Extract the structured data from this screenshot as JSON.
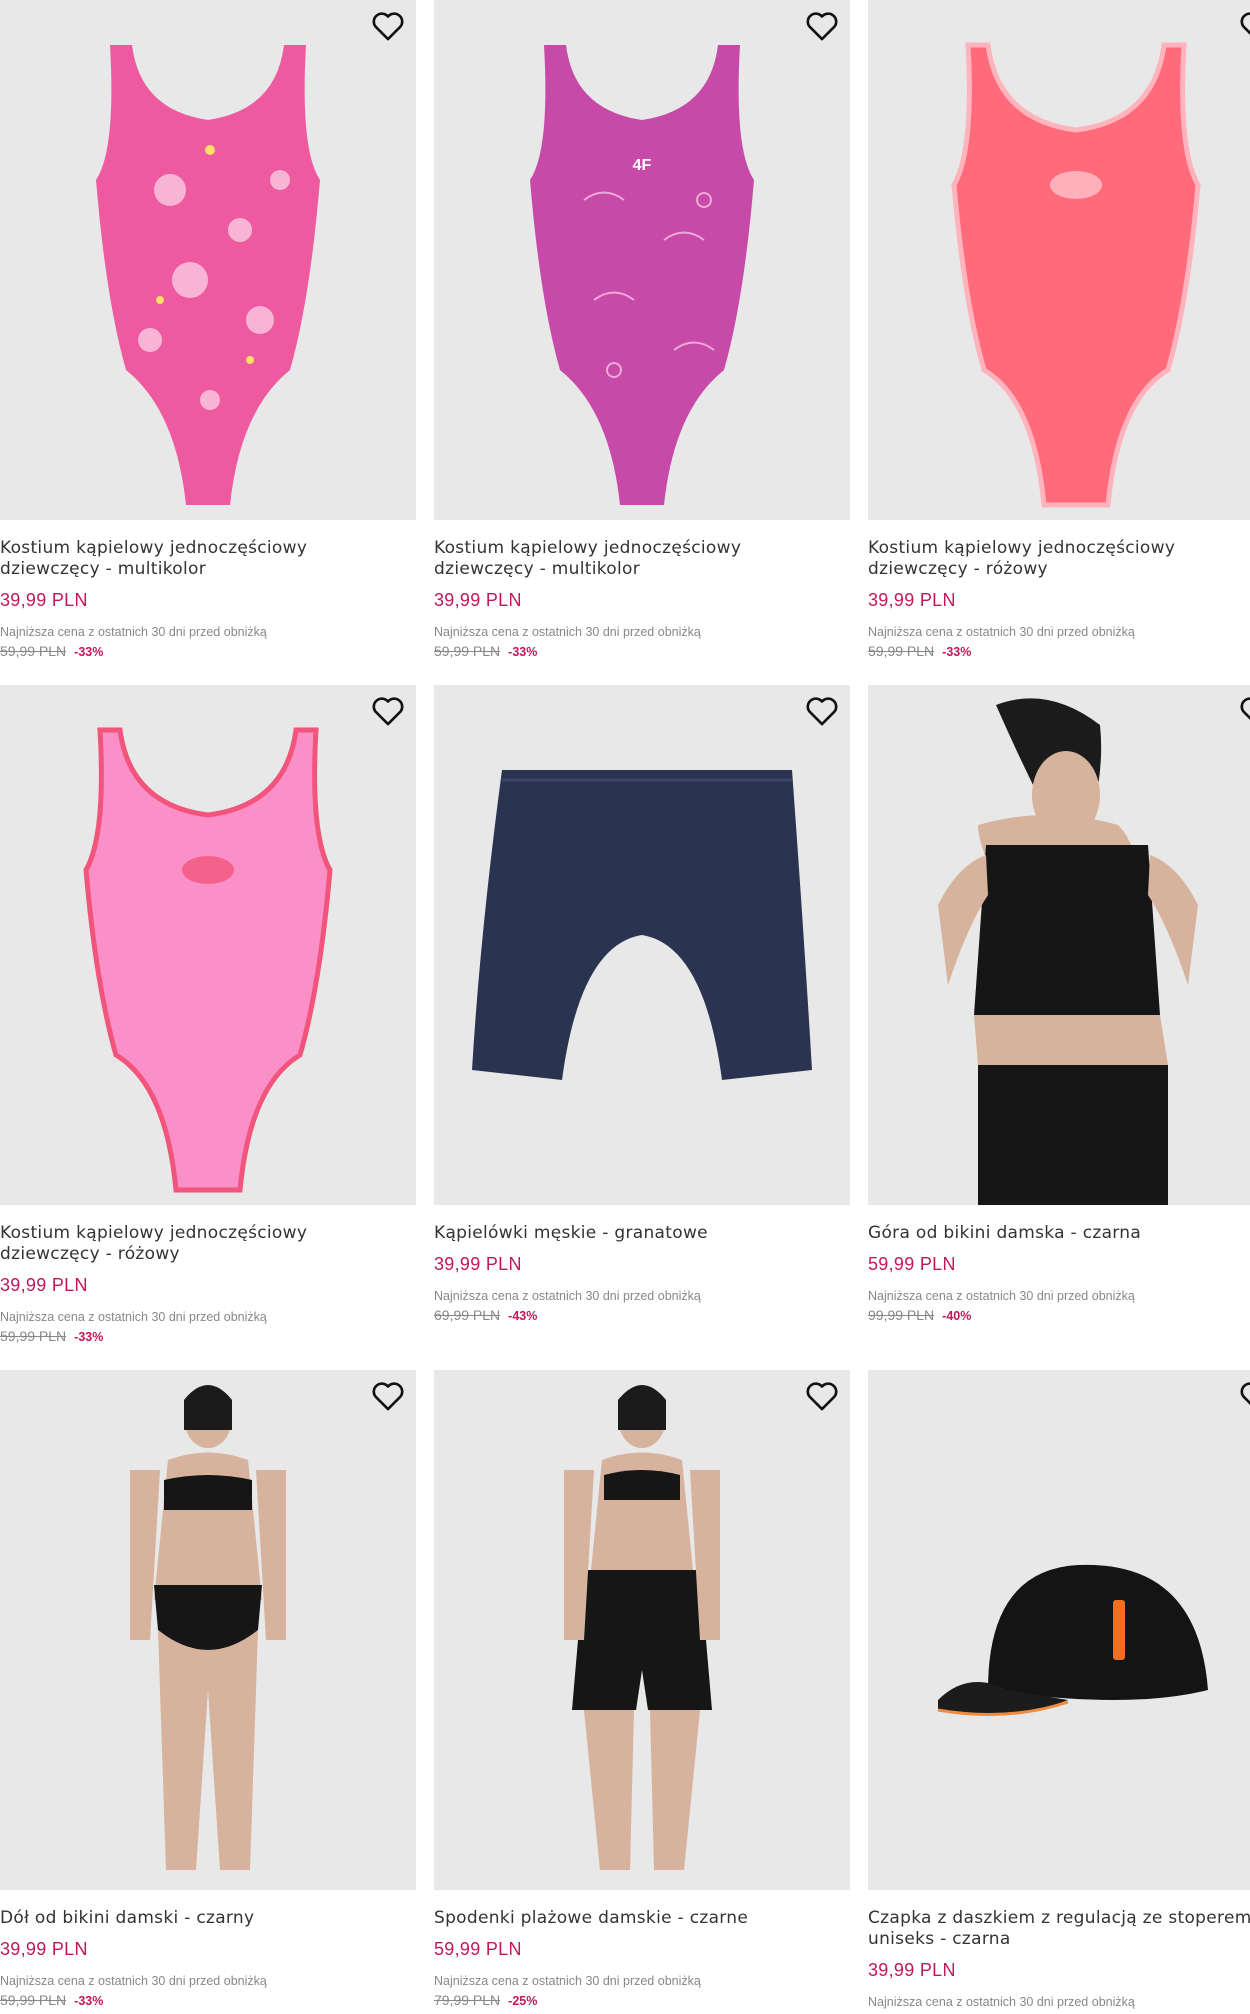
{
  "products": [
    {
      "title": "Kostium kąpielowy jednoczęściowy\ndziewczęcy - multikolor",
      "price": "39,99 PLN",
      "lowest_label": "Najniższa cena z ostatnich 30 dni przed obniżką",
      "old_price": "59,99 PLN",
      "discount": "-33%",
      "image": "pink-floral-swimsuit",
      "color": "#ee5aa0"
    },
    {
      "title": "Kostium kąpielowy jednoczęściowy\ndziewczęcy - multikolor",
      "price": "39,99 PLN",
      "lowest_label": "Najniższa cena z ostatnich 30 dni przed obniżką",
      "old_price": "59,99 PLN",
      "discount": "-33%",
      "image": "magenta-dolphin-swimsuit",
      "color": "#c84aa8"
    },
    {
      "title": "Kostium kąpielowy jednoczęściowy\ndziewczęcy - różowy",
      "price": "39,99 PLN",
      "lowest_label": "Najniższa cena z ostatnich 30 dni przed obniżką",
      "old_price": "59,99 PLN",
      "discount": "-33%",
      "image": "coral-swimsuit",
      "color": "#ff6b7a"
    },
    {
      "title": "Kostium kąpielowy jednoczęściowy\ndziewczęcy - różowy",
      "price": "39,99 PLN",
      "lowest_label": "Najniższa cena z ostatnich 30 dni przed obniżką",
      "old_price": "59,99 PLN",
      "discount": "-33%",
      "image": "light-pink-swimsuit",
      "color": "#fb8fc8"
    },
    {
      "title": "Kąpielówki męskie - granatowe",
      "price": "39,99 PLN",
      "lowest_label": "Najniższa cena z ostatnich 30 dni przed obniżką",
      "old_price": "69,99 PLN",
      "discount": "-43%",
      "image": "navy-swim-shorts",
      "color": "#2a3350"
    },
    {
      "title": "Góra od bikini damska - czarna",
      "price": "59,99 PLN",
      "lowest_label": "Najniższa cena z ostatnich 30 dni przed obniżką",
      "old_price": "99,99 PLN",
      "discount": "-40%",
      "image": "woman-black-crop-top",
      "color": "#111111"
    },
    {
      "title": "Dół od bikini damski - czarny",
      "price": "39,99 PLN",
      "lowest_label": "Najniższa cena z ostatnich 30 dni przed obniżką",
      "old_price": "59,99 PLN",
      "discount": "-33%",
      "image": "woman-black-bikini",
      "color": "#111111"
    },
    {
      "title": "Spodenki plażowe damskie - czarne",
      "price": "59,99 PLN",
      "lowest_label": "Najniższa cena z ostatnich 30 dni przed obniżką",
      "old_price": "79,99 PLN",
      "discount": "-25%",
      "image": "woman-black-beach-shorts",
      "color": "#111111"
    },
    {
      "title": "Czapka z daszkiem z regulacją ze stoperem\nuniseks - czarna",
      "price": "39,99 PLN",
      "lowest_label": "Najniższa cena z ostatnich 30 dni przed obniżką",
      "old_price": "",
      "discount": "",
      "image": "black-cap",
      "color": "#111111"
    }
  ],
  "accent_color": "#c2185b"
}
